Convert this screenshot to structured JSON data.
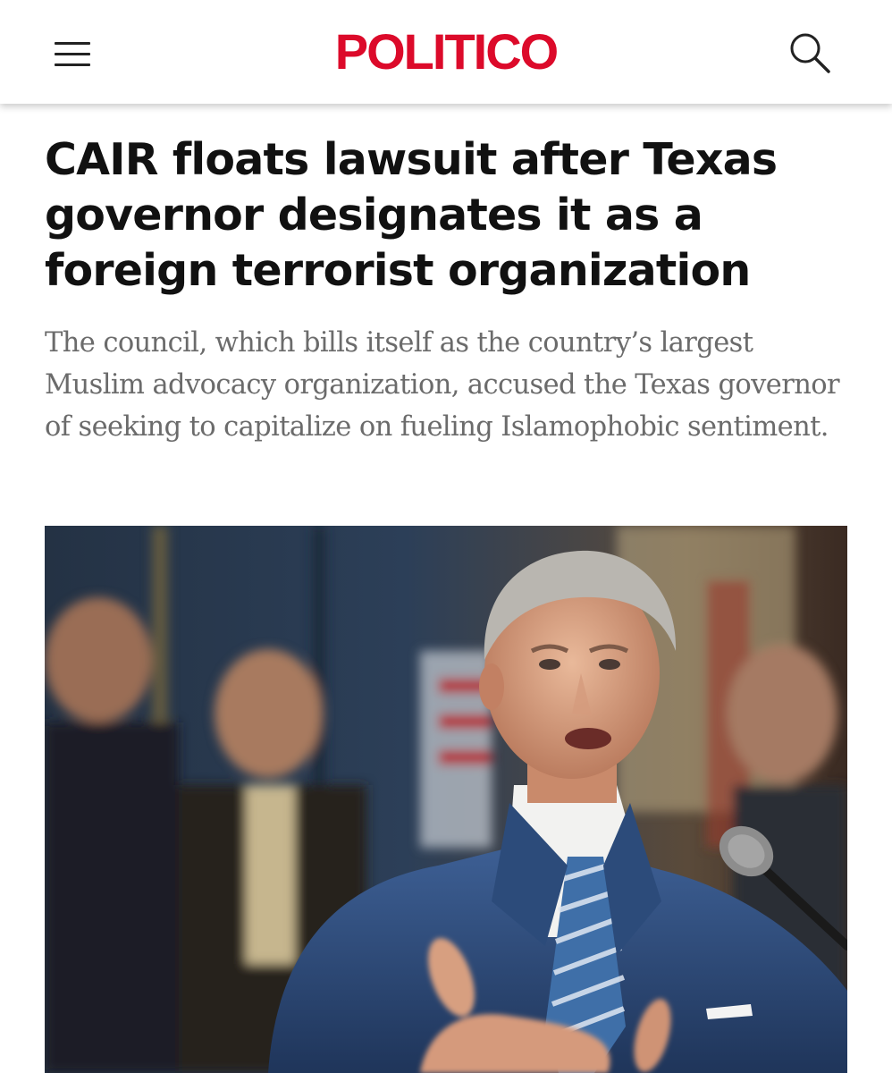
{
  "header": {
    "menu_icon": "hamburger-menu-icon",
    "logo_text": "POLITICO",
    "search_icon": "search-icon",
    "brand_color": "#dc0a2a"
  },
  "article": {
    "headline": "CAIR floats lawsuit after Texas governor designates it as a foreign terrorist organization",
    "dek": "The council, which bills itself as the country’s largest Muslim advocacy organization, accused the Texas governor of seeking to capitalize on fueling Islamophobic sentiment."
  }
}
